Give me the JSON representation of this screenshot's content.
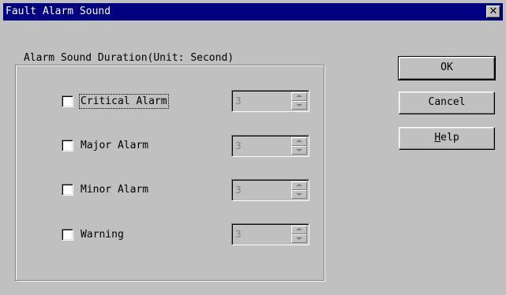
{
  "window": {
    "title": "Fault Alarm Sound",
    "close_glyph": "✕"
  },
  "group": {
    "label": "Alarm Sound Duration(Unit: Second)"
  },
  "alarms": [
    {
      "label": "Critical Alarm",
      "checked": false,
      "value": "3"
    },
    {
      "label": "Major Alarm",
      "checked": false,
      "value": "3"
    },
    {
      "label": "Minor Alarm",
      "checked": false,
      "value": "3"
    },
    {
      "label": "Warning",
      "checked": false,
      "value": "3"
    }
  ],
  "buttons": {
    "ok": "OK",
    "cancel": "Cancel",
    "help_accel": "H",
    "help_rest": "elp"
  }
}
